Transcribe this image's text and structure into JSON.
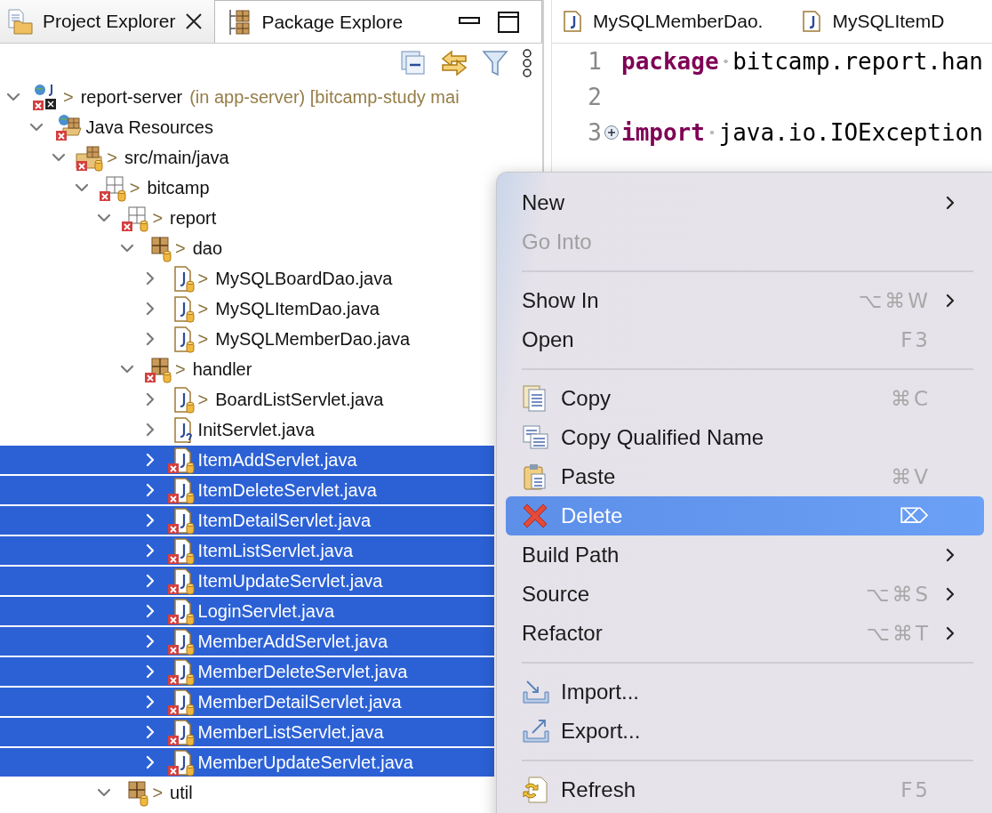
{
  "explorer": {
    "tabs": [
      {
        "label": "Project Explorer",
        "closable": true,
        "selected": true
      },
      {
        "label": "Package Explore",
        "closable": false,
        "selected": false
      }
    ],
    "tree": [
      {
        "label": "report-server",
        "kind": "project",
        "prefix": ">",
        "decoration": "(in app-server) [bitcamp-study mai",
        "expanded": true,
        "selected": false,
        "error": true,
        "children": [
          {
            "label": "Java Resources",
            "kind": "resources",
            "expanded": true,
            "selected": false,
            "error": true,
            "children": [
              {
                "label": "src/main/java",
                "kind": "source-folder",
                "prefix": ">",
                "expanded": true,
                "selected": false,
                "error": true,
                "untracked": false,
                "children": [
                  {
                    "label": "bitcamp",
                    "kind": "empty-package",
                    "prefix": ">",
                    "expanded": true,
                    "selected": false,
                    "error": true,
                    "untracked": false,
                    "children": [
                      {
                        "label": "report",
                        "kind": "empty-package",
                        "prefix": ">",
                        "expanded": true,
                        "selected": false,
                        "error": true,
                        "untracked": false,
                        "children": [
                          {
                            "label": "dao",
                            "kind": "package",
                            "prefix": ">",
                            "expanded": true,
                            "selected": false,
                            "error": false,
                            "untracked": false,
                            "children": [
                              {
                                "label": "MySQLBoardDao.java",
                                "kind": "java",
                                "prefix": ">",
                                "expanded": false,
                                "selected": false,
                                "error": false,
                                "untracked": false
                              },
                              {
                                "label": "MySQLItemDao.java",
                                "kind": "java",
                                "prefix": ">",
                                "expanded": false,
                                "selected": false,
                                "error": false,
                                "untracked": false
                              },
                              {
                                "label": "MySQLMemberDao.java",
                                "kind": "java",
                                "prefix": ">",
                                "expanded": false,
                                "selected": false,
                                "error": false,
                                "untracked": false
                              }
                            ]
                          },
                          {
                            "label": "handler",
                            "kind": "package",
                            "prefix": ">",
                            "expanded": true,
                            "selected": false,
                            "error": true,
                            "untracked": false,
                            "children": [
                              {
                                "label": "BoardListServlet.java",
                                "kind": "java",
                                "prefix": ">",
                                "expanded": false,
                                "selected": false,
                                "error": false,
                                "untracked": false
                              },
                              {
                                "label": "InitServlet.java",
                                "kind": "java",
                                "expanded": false,
                                "selected": false,
                                "error": false,
                                "untracked": true
                              },
                              {
                                "label": "ItemAddServlet.java",
                                "kind": "java",
                                "expanded": false,
                                "selected": true,
                                "error": true,
                                "untracked": false
                              },
                              {
                                "label": "ItemDeleteServlet.java",
                                "kind": "java",
                                "expanded": false,
                                "selected": true,
                                "error": true,
                                "untracked": false
                              },
                              {
                                "label": "ItemDetailServlet.java",
                                "kind": "java",
                                "expanded": false,
                                "selected": true,
                                "error": true,
                                "untracked": false
                              },
                              {
                                "label": "ItemListServlet.java",
                                "kind": "java",
                                "expanded": false,
                                "selected": true,
                                "error": true,
                                "untracked": false
                              },
                              {
                                "label": "ItemUpdateServlet.java",
                                "kind": "java",
                                "expanded": false,
                                "selected": true,
                                "error": true,
                                "untracked": false
                              },
                              {
                                "label": "LoginServlet.java",
                                "kind": "java",
                                "expanded": false,
                                "selected": true,
                                "error": true,
                                "untracked": false
                              },
                              {
                                "label": "MemberAddServlet.java",
                                "kind": "java",
                                "expanded": false,
                                "selected": true,
                                "error": true,
                                "untracked": false
                              },
                              {
                                "label": "MemberDeleteServlet.java",
                                "kind": "java",
                                "expanded": false,
                                "selected": true,
                                "error": true,
                                "untracked": false
                              },
                              {
                                "label": "MemberDetailServlet.java",
                                "kind": "java",
                                "expanded": false,
                                "selected": true,
                                "error": true,
                                "untracked": false
                              },
                              {
                                "label": "MemberListServlet.java",
                                "kind": "java",
                                "expanded": false,
                                "selected": true,
                                "error": true,
                                "untracked": false
                              },
                              {
                                "label": "MemberUpdateServlet.java",
                                "kind": "java",
                                "expanded": false,
                                "selected": true,
                                "error": true,
                                "untracked": false
                              }
                            ]
                          }
                        ]
                      },
                      {
                        "label": "util",
                        "kind": "package",
                        "prefix": ">",
                        "expanded": true,
                        "selected": false,
                        "error": false,
                        "untracked": false
                      }
                    ]
                  }
                ]
              }
            ]
          }
        ]
      }
    ]
  },
  "editor": {
    "tabs": [
      {
        "label": "MySQLMemberDao.",
        "selected": false
      },
      {
        "label": "MySQLItemD",
        "selected": false
      }
    ],
    "lines": [
      {
        "number": "1",
        "folded": false,
        "tokens": [
          {
            "kind": "keyword",
            "text": "package"
          },
          {
            "kind": "space"
          },
          {
            "kind": "plain",
            "text": "bitcamp.report.han"
          }
        ]
      },
      {
        "number": "2",
        "folded": false
      },
      {
        "number": "3",
        "folded": true,
        "tokens": [
          {
            "kind": "keyword",
            "text": "import"
          },
          {
            "kind": "space"
          },
          {
            "kind": "plain",
            "text": "java.io.IOException"
          }
        ]
      }
    ]
  },
  "context_menu": [
    {
      "kind": "plain",
      "label": "New",
      "submenu": true,
      "disabled": false,
      "selected": false
    },
    {
      "kind": "plain",
      "label": "Go Into",
      "submenu": false,
      "disabled": true,
      "selected": false
    },
    {
      "kind": "separator"
    },
    {
      "kind": "plain",
      "label": "Show In",
      "shortcut": "⌥⌘W",
      "submenu": true,
      "disabled": false,
      "selected": false
    },
    {
      "kind": "plain",
      "label": "Open",
      "shortcut": "F3",
      "submenu": false,
      "disabled": false,
      "selected": false
    },
    {
      "kind": "separator"
    },
    {
      "kind": "copy",
      "label": "Copy",
      "shortcut": "⌘C",
      "submenu": false,
      "disabled": false,
      "selected": false
    },
    {
      "kind": "copy-qualified",
      "label": "Copy Qualified Name",
      "submenu": false,
      "disabled": false,
      "selected": false
    },
    {
      "kind": "paste",
      "label": "Paste",
      "shortcut": "⌘V",
      "submenu": false,
      "disabled": false,
      "selected": false
    },
    {
      "kind": "delete",
      "label": "Delete",
      "shortcut": "⌦",
      "submenu": false,
      "disabled": false,
      "selected": true
    },
    {
      "kind": "plain",
      "label": "Build Path",
      "submenu": true,
      "disabled": false,
      "selected": false
    },
    {
      "kind": "plain",
      "label": "Source",
      "shortcut": "⌥⌘S",
      "submenu": true,
      "disabled": false,
      "selected": false
    },
    {
      "kind": "plain",
      "label": "Refactor",
      "shortcut": "⌥⌘T",
      "submenu": true,
      "disabled": false,
      "selected": false
    },
    {
      "kind": "separator"
    },
    {
      "kind": "import",
      "label": "Import...",
      "submenu": false,
      "disabled": false,
      "selected": false
    },
    {
      "kind": "export",
      "label": "Export...",
      "submenu": false,
      "disabled": false,
      "selected": false
    },
    {
      "kind": "separator"
    },
    {
      "kind": "refresh",
      "label": "Refresh",
      "shortcut": "F5",
      "submenu": false,
      "disabled": false,
      "selected": false
    }
  ]
}
